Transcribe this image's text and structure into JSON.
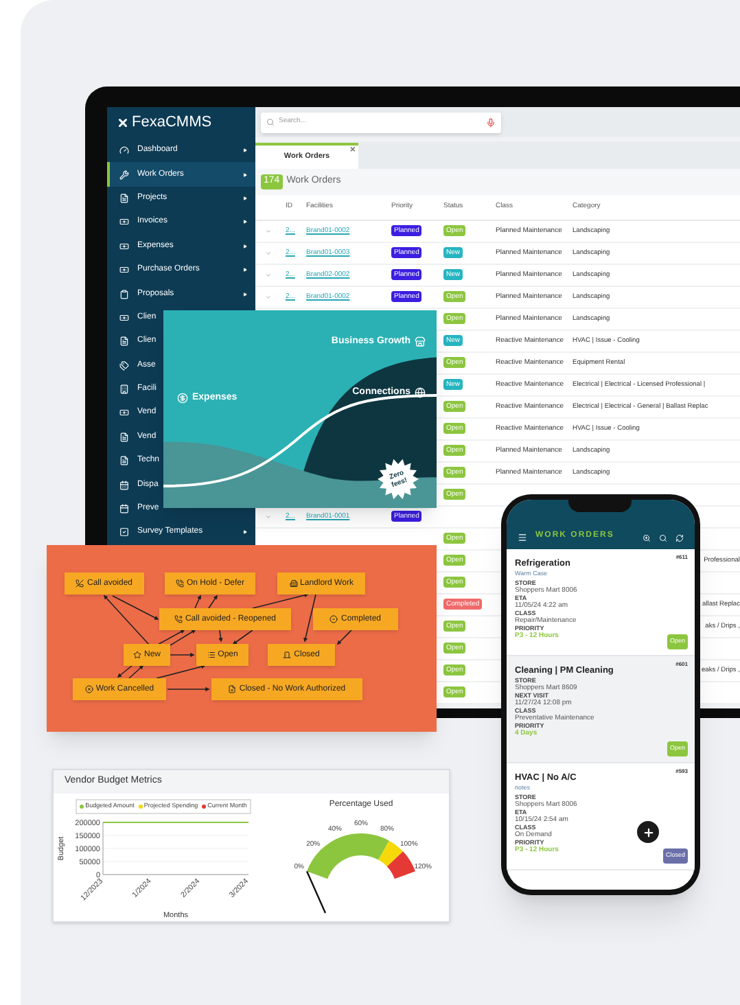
{
  "sidebar": {
    "logo": "**Fexa**CMMS",
    "items": [
      {
        "label": "Dashboard",
        "selected": false,
        "expandable": true
      },
      {
        "label": "Work Orders",
        "selected": true,
        "expandable": true
      },
      {
        "label": "Projects",
        "selected": false,
        "expandable": true
      },
      {
        "label": "Invoices",
        "selected": false,
        "expandable": true
      },
      {
        "label": "Expenses",
        "selected": false,
        "expandable": true
      },
      {
        "label": "Purchase Orders",
        "selected": false,
        "expandable": true
      },
      {
        "label": "Proposals",
        "selected": false,
        "expandable": true
      },
      {
        "label": "Clien",
        "selected": false,
        "expandable": false
      },
      {
        "label": "Clien",
        "selected": false,
        "expandable": false
      },
      {
        "label": "Asse",
        "selected": false,
        "expandable": false
      },
      {
        "label": "Facili",
        "selected": false,
        "expandable": false
      },
      {
        "label": "Vend",
        "selected": false,
        "expandable": false
      },
      {
        "label": "Vend",
        "selected": false,
        "expandable": false
      },
      {
        "label": "Techn",
        "selected": false,
        "expandable": false
      },
      {
        "label": "Dispa",
        "selected": false,
        "expandable": false
      },
      {
        "label": "Preve",
        "selected": false,
        "expandable": false
      },
      {
        "label": "Survey Templates",
        "selected": false,
        "expandable": true
      }
    ]
  },
  "search": {
    "placeholder": "Search..."
  },
  "tabs": [
    {
      "label": "Work Orders",
      "selected": true,
      "close": "×"
    }
  ],
  "list_header": {
    "count": "174",
    "title": "Work Orders"
  },
  "table": {
    "columns": [
      "ID",
      "Facilities",
      "Priority",
      "Status",
      "Class",
      "Category"
    ],
    "rows": [
      {
        "id": "2...",
        "facility": "Brand01-0002",
        "priority": {
          "text": "Planned",
          "kind": "planned"
        },
        "status": {
          "text": "Open",
          "kind": "open"
        },
        "class": "Planned Maintenance",
        "category": "Landscaping"
      },
      {
        "id": "2...",
        "facility": "Brand01-0003",
        "priority": {
          "text": "Planned",
          "kind": "planned"
        },
        "status": {
          "text": "New",
          "kind": "new"
        },
        "class": "Planned Maintenance",
        "category": "Landscaping"
      },
      {
        "id": "2...",
        "facility": "Brand02-0002",
        "priority": {
          "text": "Planned",
          "kind": "planned"
        },
        "status": {
          "text": "New",
          "kind": "new"
        },
        "class": "Planned Maintenance",
        "category": "Landscaping"
      },
      {
        "id": "2...",
        "facility": "Brand01-0002",
        "priority": {
          "text": "Planned",
          "kind": "planned"
        },
        "status": {
          "text": "Open",
          "kind": "open"
        },
        "class": "Planned Maintenance",
        "category": "Landscaping"
      },
      {
        "status": {
          "text": "Open",
          "kind": "open"
        },
        "class": "Planned Maintenance",
        "category": "Landscaping"
      },
      {
        "status": {
          "text": "New",
          "kind": "new"
        },
        "class": "Reactive Maintenance",
        "category": "HVAC | Issue - Cooling"
      },
      {
        "status": {
          "text": "Open",
          "kind": "open"
        },
        "class": "Reactive Maintenance",
        "category": "Equipment Rental"
      },
      {
        "status": {
          "text": "New",
          "kind": "new"
        },
        "class": "Reactive Maintenance",
        "category": "Electrical | Electrical - Licensed Professional |"
      },
      {
        "status": {
          "text": "Open",
          "kind": "open"
        },
        "class": "Reactive Maintenance",
        "category": "Electrical | Electrical - General | Ballast Replac"
      },
      {
        "status": {
          "text": "Open",
          "kind": "open"
        },
        "class": "Reactive Maintenance",
        "category": "HVAC | Issue - Cooling"
      },
      {
        "status": {
          "text": "Open",
          "kind": "open"
        },
        "class": "Planned Maintenance",
        "category": "Landscaping"
      },
      {
        "status": {
          "text": "Open",
          "kind": "open"
        },
        "class": "Planned Maintenance",
        "category": "Landscaping"
      },
      {
        "status": {
          "text": "Open",
          "kind": "open"
        }
      },
      {
        "id": "2...",
        "facility": "Brand01-0001",
        "priority": {
          "text": "Planned",
          "kind": "planned"
        }
      },
      {
        "status": {
          "text": "Open",
          "kind": "open"
        }
      },
      {
        "status": {
          "text": "Open",
          "kind": "open"
        },
        "category": "Professional"
      },
      {
        "status": {
          "text": "Open",
          "kind": "open"
        }
      },
      {
        "status": {
          "text": "Completed",
          "kind": "completed"
        },
        "category": "allast Replac"
      },
      {
        "status": {
          "text": "Open",
          "kind": "open"
        },
        "category": "aks / Drips ,"
      },
      {
        "status": {
          "text": "Open",
          "kind": "open"
        }
      },
      {
        "status": {
          "text": "Open",
          "kind": "open"
        },
        "category": "eaks / Drips ,"
      },
      {
        "status": {
          "text": "Open",
          "kind": "open"
        }
      }
    ]
  },
  "promo_card": {
    "left_label": "Expenses",
    "top_label": "Business Growth",
    "middle_label": "Connections",
    "badge": "Zero fees!"
  },
  "workflow": {
    "nodes": [
      "Call avoided",
      "On Hold - Defer",
      "Landlord Work",
      "Call avoided - Reopened",
      "Completed",
      "New",
      "Open",
      "Closed",
      "Work Cancelled",
      "Closed - No Work Authorized"
    ]
  },
  "budget_card": {
    "title": "Vendor Budget Metrics",
    "chart_data": {
      "type": "line",
      "xlabel": "Months",
      "ylabel": "Budget",
      "categories": [
        "12/2023",
        "1/2024",
        "2/2024",
        "3/2024"
      ],
      "series": [
        {
          "name": "Budgeted Amount",
          "color": "#8cc63f",
          "values": [
            200000,
            200000,
            200000,
            200000
          ]
        },
        {
          "name": "Projected Spending",
          "color": "#f5d90a",
          "values": [
            null,
            null,
            null,
            null
          ]
        },
        {
          "name": "Current Month",
          "color": "#e53935",
          "values": [
            null,
            null,
            null,
            null
          ]
        }
      ],
      "ylim": [
        0,
        200000
      ],
      "yticks": [
        0,
        50000,
        100000,
        150000,
        200000
      ],
      "grid": true
    },
    "gauge": {
      "title": "Percentage Used",
      "scale": [
        "0%",
        "20%",
        "40%",
        "60%",
        "80%",
        "100%",
        "120%"
      ]
    }
  },
  "phone": {
    "title": "WORK ORDERS",
    "cards": [
      {
        "title": "Refrigeration",
        "number": "#611",
        "subtitle": "Warm Case",
        "selected": false,
        "fields": [
          {
            "label": "STORE",
            "value": "Shoppers Mart 8006",
            "kind": "text"
          },
          {
            "label": "ETA",
            "value": "11/05/24 4:22 am",
            "kind": "text"
          },
          {
            "label": "CLASS",
            "value": "Repair/Maintenance",
            "kind": "text"
          },
          {
            "label": "PRIORITY",
            "value": "P3 - 12 Hours",
            "kind": "priority"
          }
        ],
        "status": {
          "text": "Open",
          "kind": "open"
        }
      },
      {
        "title": "Cleaning | PM Cleaning",
        "number": "#601",
        "selected": true,
        "fields": [
          {
            "label": "STORE",
            "value": "Shoppers Mart 8609",
            "kind": "text"
          },
          {
            "label": "NEXT VISIT",
            "value": "11/27/24 12:08 pm",
            "kind": "text"
          },
          {
            "label": "CLASS",
            "value": "Preventative Maintenance",
            "kind": "text"
          },
          {
            "label": "PRIORITY",
            "value": "4 Days",
            "kind": "priority"
          }
        ],
        "status": {
          "text": "Open",
          "kind": "open"
        }
      },
      {
        "title": "HVAC | No A/C",
        "number": "#593",
        "subtitle": "notes",
        "selected": false,
        "fields": [
          {
            "label": "STORE",
            "value": "Shoppers Mart 8006",
            "kind": "text"
          },
          {
            "label": "ETA",
            "value": "10/15/24 2:54 am",
            "kind": "text"
          },
          {
            "label": "CLASS",
            "value": "On Demand",
            "kind": "text"
          },
          {
            "label": "PRIORITY",
            "value": "P3 - 12 Hours",
            "kind": "priority"
          }
        ],
        "status": {
          "text": "Closed",
          "kind": "closed"
        }
      }
    ]
  }
}
